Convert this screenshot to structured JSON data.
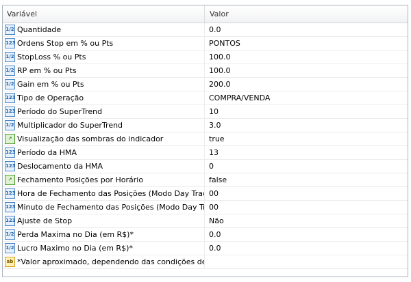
{
  "header": {
    "col_variable": "Variável",
    "col_value": "Valor"
  },
  "rows": [
    {
      "name": "Quantidade",
      "value": "0.0",
      "icon": "half-icon",
      "icon_text": "1/2",
      "icon_color": "blue"
    },
    {
      "name": "Ordens Stop em % ou Pts",
      "value": "PONTOS",
      "icon": "enum-icon",
      "icon_text": "123",
      "icon_color": "blue"
    },
    {
      "name": "StopLoss % ou Pts",
      "value": "100.0",
      "icon": "half-icon",
      "icon_text": "1/2",
      "icon_color": "blue"
    },
    {
      "name": "RP em % ou Pts",
      "value": "100.0",
      "icon": "half-icon",
      "icon_text": "1/2",
      "icon_color": "blue"
    },
    {
      "name": "Gain em % ou Pts",
      "value": "200.0",
      "icon": "half-icon",
      "icon_text": "1/2",
      "icon_color": "blue"
    },
    {
      "name": "Tipo de Operação",
      "value": "COMPRA/VENDA",
      "icon": "enum-icon",
      "icon_text": "123",
      "icon_color": "blue"
    },
    {
      "name": "Período do SuperTrend",
      "value": "10",
      "icon": "enum-icon",
      "icon_text": "123",
      "icon_color": "blue"
    },
    {
      "name": "Multiplicador do SuperTrend",
      "value": "3.0",
      "icon": "half-icon",
      "icon_text": "1/2",
      "icon_color": "blue"
    },
    {
      "name": "Visualização das sombras do indicador",
      "value": "true",
      "icon": "bool-icon",
      "icon_text": "↗",
      "icon_color": "green"
    },
    {
      "name": "Período da HMA",
      "value": "13",
      "icon": "enum-icon",
      "icon_text": "123",
      "icon_color": "blue"
    },
    {
      "name": "Deslocamento da HMA",
      "value": "0",
      "icon": "enum-icon",
      "icon_text": "123",
      "icon_color": "blue"
    },
    {
      "name": "Fechamento Posições por Horário",
      "value": "false",
      "icon": "bool-icon",
      "icon_text": "↗",
      "icon_color": "green"
    },
    {
      "name": "Hora de Fechamento das Posições (Modo Day Trade)",
      "value": "00",
      "icon": "enum-icon",
      "icon_text": "123",
      "icon_color": "blue"
    },
    {
      "name": "Minuto de Fechamento das Posições (Modo Day Trade)",
      "value": "00",
      "icon": "enum-icon",
      "icon_text": "123",
      "icon_color": "blue"
    },
    {
      "name": "Ajuste de Stop",
      "value": "Não",
      "icon": "enum-icon",
      "icon_text": "123",
      "icon_color": "blue"
    },
    {
      "name": "Perda Maxima no Dia (em R$)*",
      "value": "0.0",
      "icon": "half-icon",
      "icon_text": "1/2",
      "icon_color": "blue"
    },
    {
      "name": "Lucro Maximo no Dia (em R$)*",
      "value": "0.0",
      "icon": "half-icon",
      "icon_text": "1/2",
      "icon_color": "blue"
    },
    {
      "name": "*Valor aproximado, dependendo das condições de me...",
      "value": "",
      "icon": "string-icon",
      "icon_text": "ab",
      "icon_color": "yellow"
    }
  ]
}
